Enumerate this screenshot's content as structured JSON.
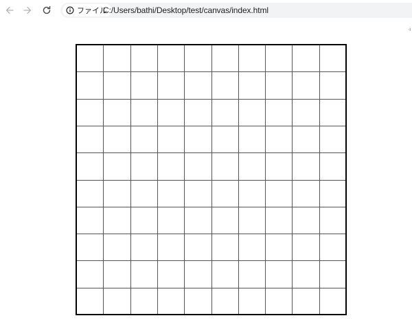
{
  "browser": {
    "back_icon": "arrow-left-icon",
    "forward_icon": "arrow-right-icon",
    "reload_icon": "reload-icon",
    "site_info": {
      "icon": "info-icon",
      "label": "ファイル"
    },
    "url": "C:/Users/bathi/Desktop/test/canvas/index.html",
    "extension_glyph": "·i"
  },
  "page": {
    "grid": {
      "rows": 10,
      "columns": 10,
      "border_color": "#000000",
      "line_color": "#555555"
    }
  }
}
